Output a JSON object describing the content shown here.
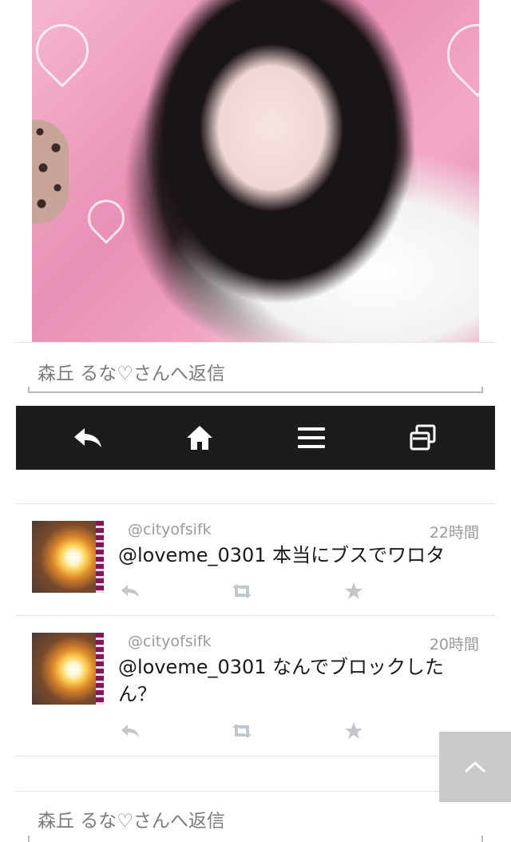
{
  "profile_photo": {
    "alt": "profile-photo"
  },
  "reply_top": {
    "placeholder": "森丘 るな♡さんへ返信"
  },
  "navbar": {
    "icons": [
      "reply-icon",
      "home-icon",
      "menu-icon",
      "windows-icon"
    ]
  },
  "tweets": [
    {
      "handle": "@cityofsifk",
      "time": "22時間",
      "text": "@loveme_0301 本当にブスでワロタ"
    },
    {
      "handle": "@cityofsifk",
      "time": "20時間",
      "text": "@loveme_0301 なんでブロックしたん？"
    }
  ],
  "reply_bottom": {
    "placeholder": "森丘 るな♡さんへ返信"
  },
  "colors": {
    "navbar": "#1c1c1c",
    "action_icon": "#c2c7cc",
    "scroll_top_button": "#c9c9c9"
  }
}
